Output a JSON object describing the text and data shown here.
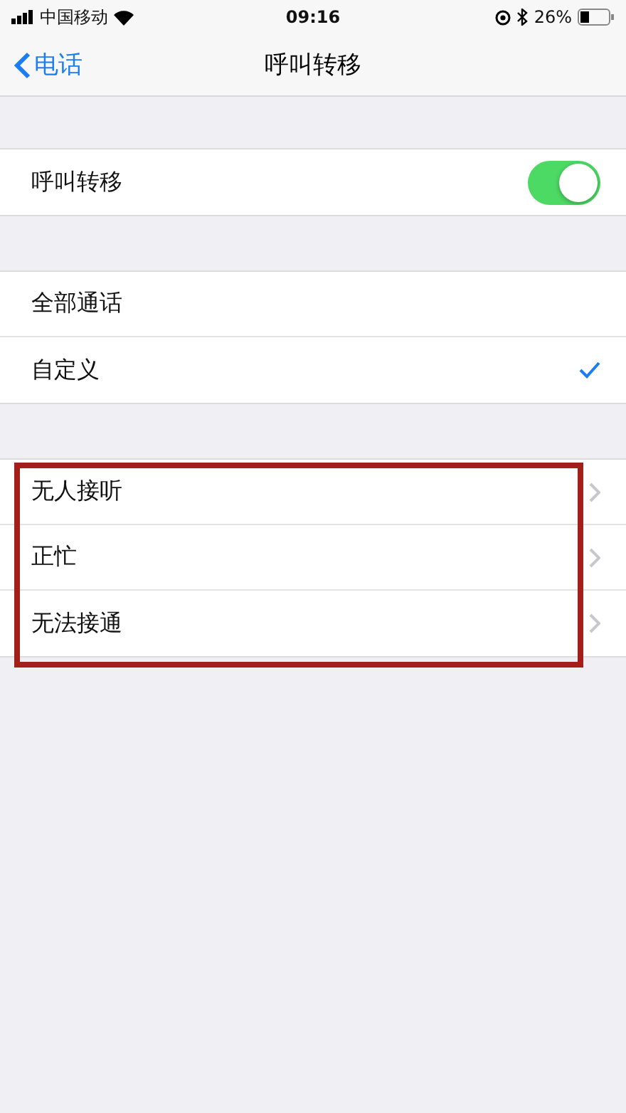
{
  "status_bar": {
    "carrier": "中国移动",
    "time": "09:16",
    "battery": "26%"
  },
  "nav": {
    "back": "电话",
    "title": "呼叫转移"
  },
  "toggle_row": {
    "label": "呼叫转移",
    "on": true
  },
  "mode_options": [
    {
      "label": "全部通话",
      "selected": false
    },
    {
      "label": "自定义",
      "selected": true
    }
  ],
  "conditions": {
    "highlighted": true,
    "items": [
      {
        "label": "无人接听"
      },
      {
        "label": "正忙"
      },
      {
        "label": "无法接通"
      }
    ]
  }
}
